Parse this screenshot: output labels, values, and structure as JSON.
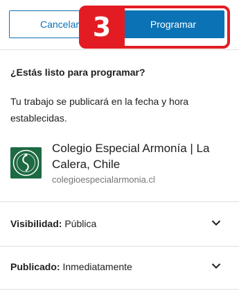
{
  "header": {
    "cancel_label": "Cancelar",
    "schedule_label": "Programar",
    "step_number": "3"
  },
  "prompt": {
    "question": "¿Estás listo para programar?",
    "description": "Tu trabajo se publicará en la fecha y hora establecidas."
  },
  "site": {
    "name": "Colegio Especial Armonía | La Calera, Chile",
    "url": "colegioespecialarmonia.cl",
    "logo_icon": "school-seal-icon",
    "logo_color": "#1d6a43"
  },
  "settings": [
    {
      "label": "Visibilidad:",
      "value": "Pública"
    },
    {
      "label": "Publicado:",
      "value": "Inmediatamente"
    }
  ],
  "colors": {
    "accent": "#0a72b5",
    "highlight": "#e31c23"
  }
}
